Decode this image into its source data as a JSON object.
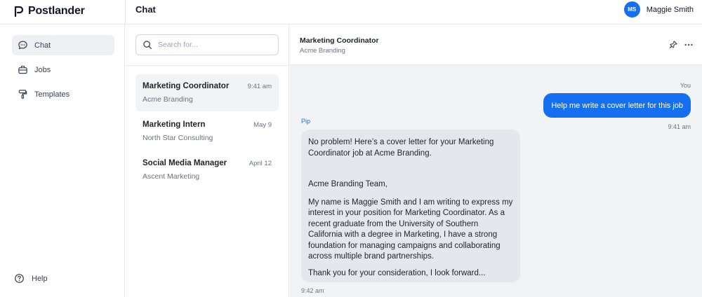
{
  "app": {
    "name": "Postlander",
    "page_title": "Chat"
  },
  "user": {
    "initials": "MS",
    "name": "Maggie Smith"
  },
  "sidebar": {
    "items": [
      {
        "label": "Chat",
        "icon": "chat-bubble-icon",
        "active": true
      },
      {
        "label": "Jobs",
        "icon": "briefcase-icon",
        "active": false
      },
      {
        "label": "Templates",
        "icon": "paint-roller-icon",
        "active": false
      }
    ],
    "help_label": "Help"
  },
  "search": {
    "placeholder": "Search for...",
    "value": ""
  },
  "conversations": [
    {
      "title": "Marketing Coordinator",
      "company": "Acme Branding",
      "time": "9:41 am",
      "active": true
    },
    {
      "title": "Marketing Intern",
      "company": "North Star Consulting",
      "time": "May 9",
      "active": false
    },
    {
      "title": "Social Media Manager",
      "company": "Ascent Marketing",
      "time": "April 12",
      "active": false
    }
  ],
  "chat": {
    "title": "Marketing Coordinator",
    "company": "Acme Branding",
    "messages": {
      "user": {
        "sender": "You",
        "text": "Help me write a cover letter for this job",
        "time": "9:41 am"
      },
      "bot": {
        "sender": "Pip",
        "paragraphs": [
          "No problem! Here’s a cover letter for your Marketing Coordinator job at Acme Branding.",
          "Acme Branding Team,",
          "My name is Maggie Smith and I am writing to express my interest in your position for Marketing Coordinator. As a recent graduate from the University of Southern California with a degree in Marketing, I have a strong foundation for managing campaigns and collaborating across multiple brand partnerships.",
          "Thank you for your consideration, I look forward..."
        ],
        "time": "9:42 am"
      }
    }
  },
  "colors": {
    "accent": "#1570ef",
    "bubble_bot": "#e4e7ec",
    "chat_bg": "#f2f3f5"
  }
}
